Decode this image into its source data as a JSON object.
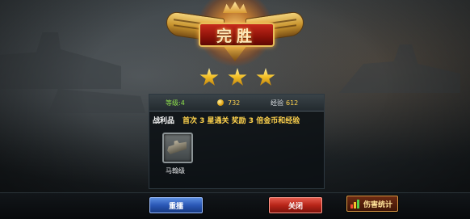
{
  "result": {
    "title": "完胜",
    "stars": 3
  },
  "stats": {
    "level": "等级:4",
    "gold": "732",
    "exp_label": "经验",
    "exp_value": "612"
  },
  "loot": {
    "label": "战利品",
    "note": "首次 3 星通关 奖励 3 倍金币和经验",
    "items": [
      {
        "name": "马翰级",
        "icon": "warship-icon"
      }
    ]
  },
  "buttons": {
    "retry": "重擂",
    "close": "关闭",
    "damage_stats": "伤害统计"
  },
  "colors": {
    "retry": "#2a57b6",
    "close": "#b72418",
    "accent_gold": "#ffd34d",
    "level_green": "#8fe34a"
  }
}
